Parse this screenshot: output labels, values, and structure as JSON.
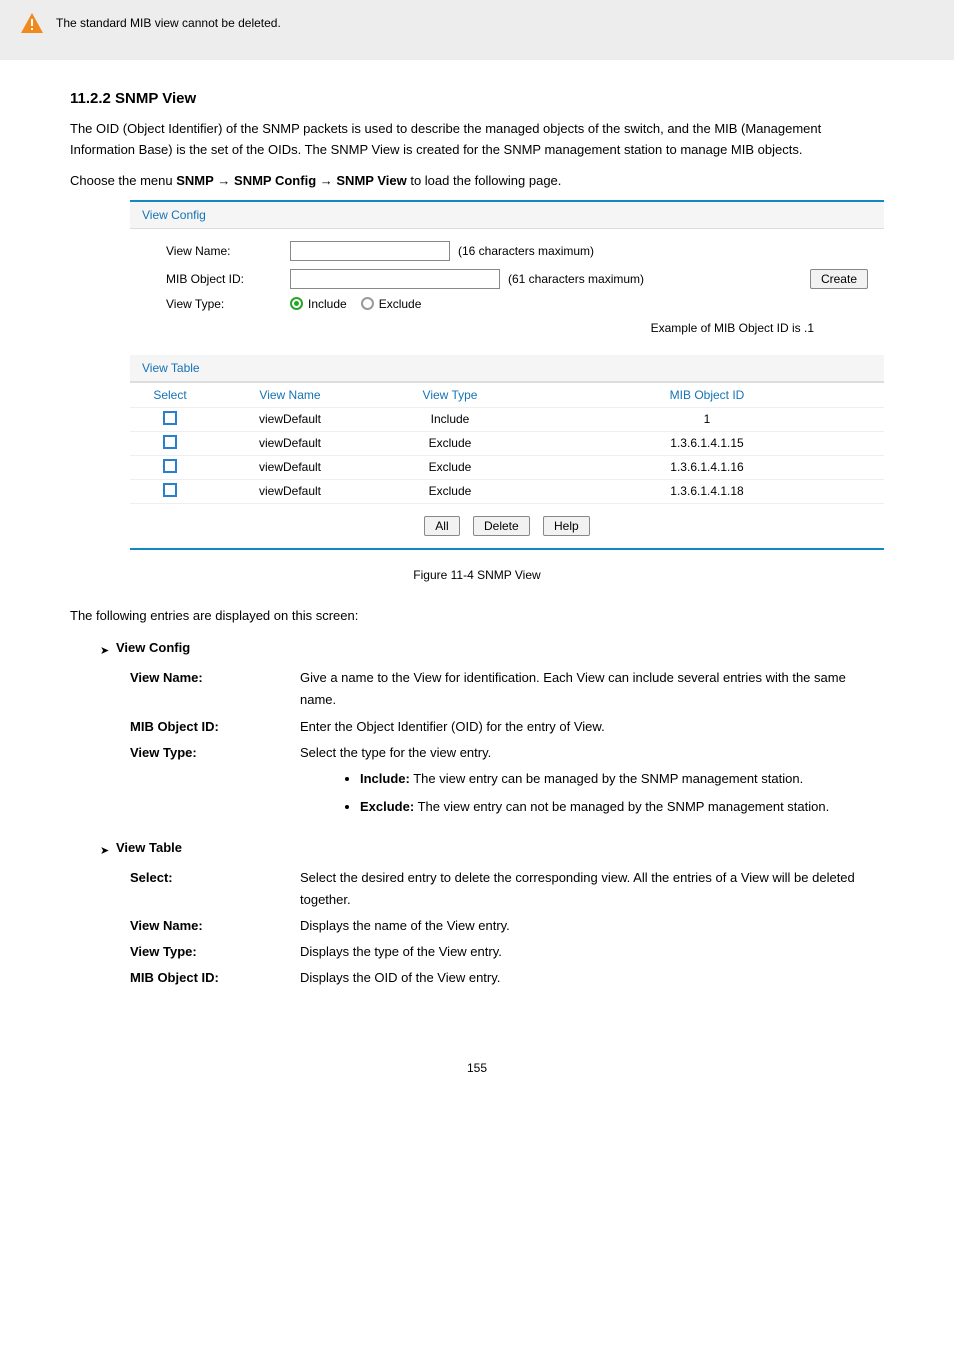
{
  "note": {
    "text": "The standard MIB view cannot be deleted."
  },
  "section_11_2_2": {
    "heading": "11.2.2 SNMP View",
    "intro": "The OID (Object Identifier) of the SNMP packets is used to describe the managed objects of the switch, and the MIB (Management Information Base) is the set of the OIDs. The SNMP View is created for the SNMP management station to manage MIB objects.",
    "breadcrumb_prefix": "Choose the menu ",
    "breadcrumb_path1": "SNMP",
    "breadcrumb_path2": "SNMP Config",
    "breadcrumb_path3": "SNMP View",
    "breadcrumb_suffix": " to load the following page."
  },
  "panel": {
    "view_config_title": "View Config",
    "labels": {
      "view_name": "View Name:",
      "mib_object_id": "MIB Object ID:",
      "view_type": "View Type:"
    },
    "hints": {
      "view_name": "(16 characters maximum)",
      "mib_object_id": "(61 characters maximum)",
      "example_oid": "Example of MIB Object ID is .1",
      "view_name_value": "",
      "mib_value": ""
    },
    "buttons": {
      "create": "Create",
      "all": "All",
      "delete": "Delete",
      "help": "Help"
    },
    "radios": {
      "include": "Include",
      "exclude": "Exclude"
    },
    "view_table_title": "View Table",
    "columns": {
      "select": "Select",
      "view_name": "View Name",
      "view_type": "View Type",
      "mib_object_id": "MIB Object ID"
    },
    "rows": [
      {
        "name": "viewDefault",
        "type": "Include",
        "oid": "1"
      },
      {
        "name": "viewDefault",
        "type": "Exclude",
        "oid": "1.3.6.1.4.1.15"
      },
      {
        "name": "viewDefault",
        "type": "Exclude",
        "oid": "1.3.6.1.4.1.16"
      },
      {
        "name": "viewDefault",
        "type": "Exclude",
        "oid": "1.3.6.1.4.1.18"
      }
    ],
    "caption": "Figure 11-4 SNMP View"
  },
  "explain": {
    "intro": "The following entries are displayed on this screen:",
    "view_config_title": "View Config",
    "view_table_title": "View Table",
    "items_config": {
      "view_name": {
        "k": "View Name:",
        "v": "Give a name to the View for identification. Each View can include several entries with the same name."
      },
      "mib_oid": {
        "k": "MIB Object ID:",
        "v": "Enter the Object Identifier (OID) for the entry of View."
      },
      "view_type": {
        "k": "View Type:",
        "v": "Select the type for the view entry.",
        "bullets": [
          {
            "b": "Include:",
            "t": " The view entry can be managed by the SNMP management station."
          },
          {
            "b": "Exclude:",
            "t": " The view entry can not be managed by the SNMP management station."
          }
        ]
      }
    },
    "items_table": {
      "select": {
        "k": "Select:",
        "v": "Select the desired entry to delete the corresponding view. All the entries of a View will be deleted together."
      },
      "viewname": {
        "k": "View Name:",
        "v": "Displays the name of the View entry."
      },
      "viewtype": {
        "k": "View Type:",
        "v": "Displays the type of the View entry."
      },
      "miboid": {
        "k": "MIB Object ID:",
        "v": "Displays the OID of the View entry."
      }
    }
  },
  "pagenum": "155"
}
